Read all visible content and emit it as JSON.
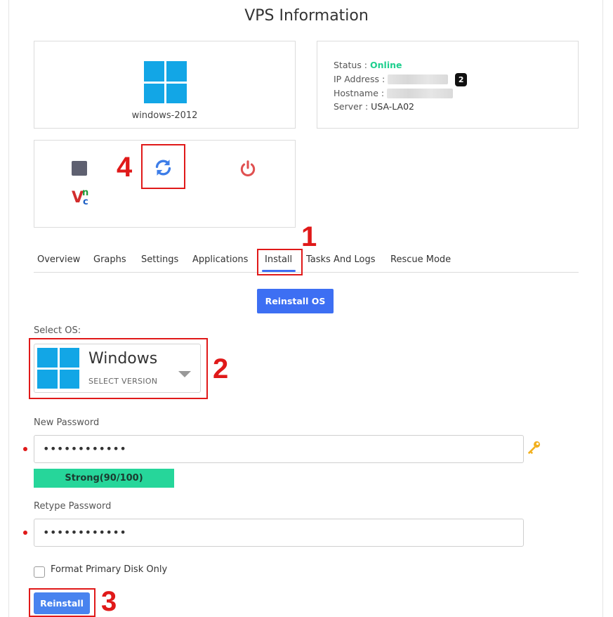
{
  "page": {
    "title": "VPS Information"
  },
  "os_card": {
    "name": "windows-2012"
  },
  "status": {
    "status_label": "Status :",
    "status_value": "Online",
    "ip_label": "IP Address :",
    "hostname_label": "Hostname :",
    "server_label": "Server :",
    "server_value": "USA-LA02",
    "ip_badge": "2"
  },
  "tabs": [
    {
      "label": "Overview"
    },
    {
      "label": "Graphs"
    },
    {
      "label": "Settings"
    },
    {
      "label": "Applications"
    },
    {
      "label": "Install",
      "active": true
    },
    {
      "label": "Tasks And Logs"
    },
    {
      "label": "Rescue Mode"
    }
  ],
  "install": {
    "reinstall_os_label": "Reinstall OS",
    "select_os_label": "Select OS:",
    "os_name": "Windows",
    "os_sub": "SELECT VERSION",
    "new_password_label": "New Password",
    "new_password_value": "••••••••••••",
    "strength": "Strong(90/100)",
    "retype_password_label": "Retype Password",
    "retype_password_value": "••••••••••••",
    "format_label": "Format Primary Disk Only",
    "reinstall_label": "Reinstall"
  },
  "annotations": {
    "a1": "1",
    "a2": "2",
    "a3": "3",
    "a4": "4"
  },
  "colors": {
    "accent": "#3d6ff3",
    "online": "#1ecf8e",
    "annotation": "#e01919",
    "windows": "#12a6e6"
  }
}
